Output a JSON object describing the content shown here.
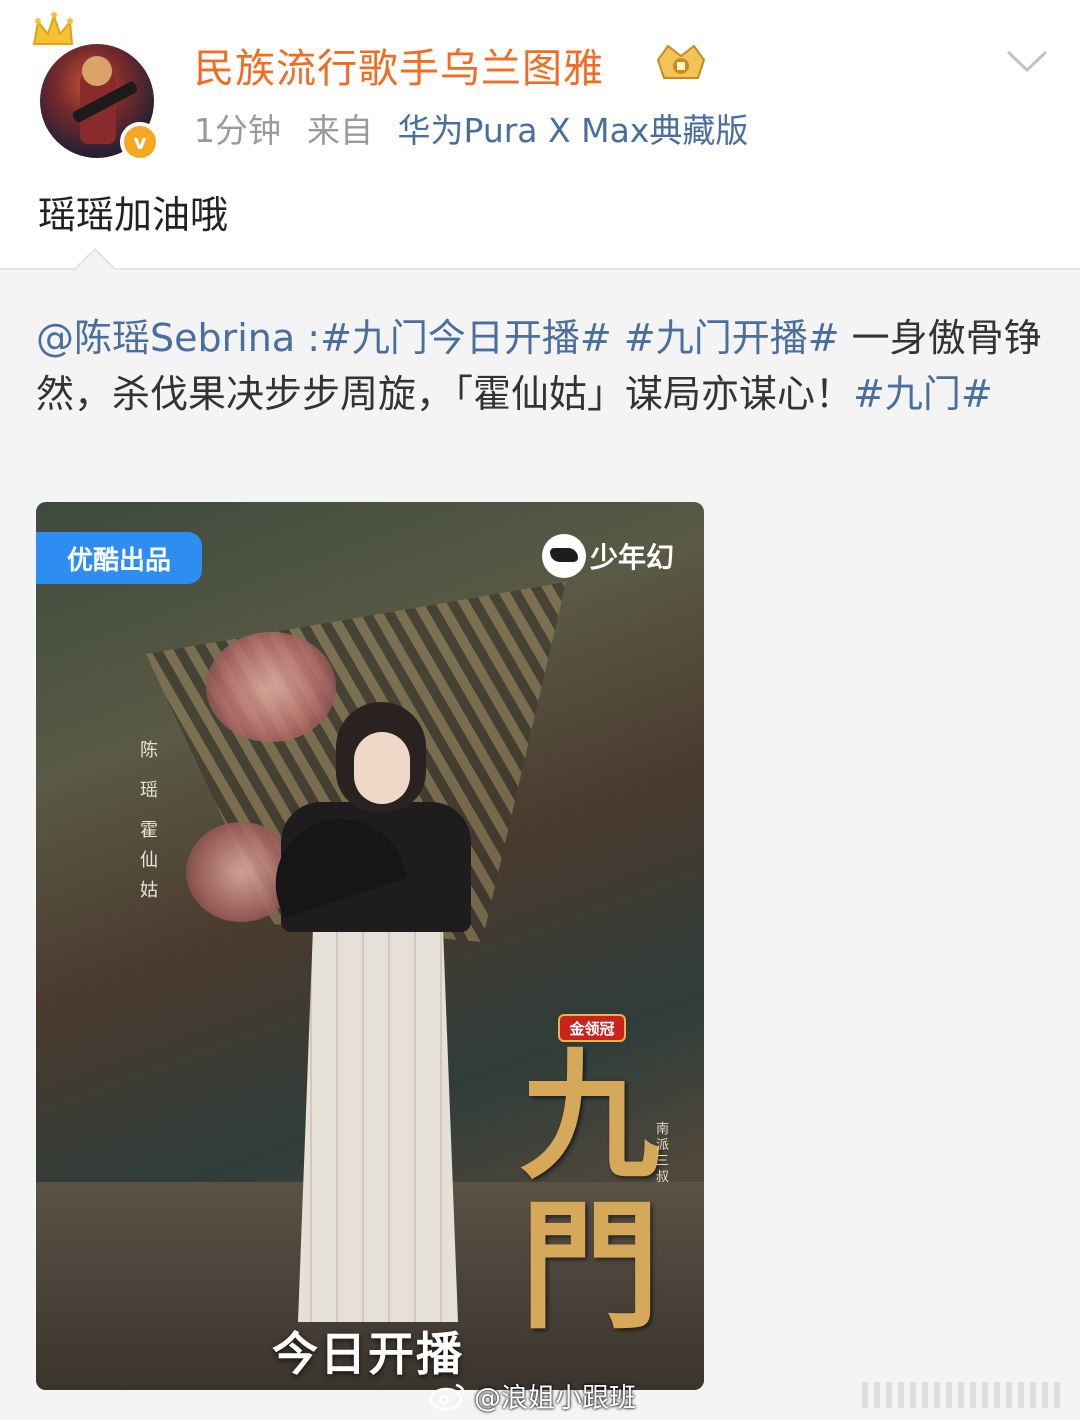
{
  "header": {
    "username": "民族流行歌手乌兰图雅",
    "time": "1分钟",
    "source_prefix": "来自",
    "device": "华为Pura X Max典藏版"
  },
  "post": {
    "text": "瑶瑶加油哦"
  },
  "repost": {
    "mention": "@陈瑶Sebrina",
    "sep": " :",
    "tag1": "#九门今日开播#",
    "tag2": "#九门开播#",
    "body": " 一身傲骨铮然，杀伐果决步步周旋，「霍仙姑」谋局亦谋心！",
    "tag3": "#九门#"
  },
  "poster": {
    "youku_tag": "优酷出品",
    "brand": "少年幻",
    "name_chars": [
      "陈",
      "瑶"
    ],
    "role_chars": [
      "霍",
      "仙",
      "姑"
    ],
    "sponsor": "金领冠",
    "title_line1": "九",
    "title_line2": "門",
    "author": "南派三叔",
    "air_text": "今日开播"
  },
  "watermark": {
    "text": "@浪姐小跟班"
  },
  "colors": {
    "username": "#f26c23",
    "link": "#4a6f9e",
    "meta": "#9a9a9a",
    "youku_blue": "#2d8df0",
    "title_gold": "#d6a85a"
  },
  "icons": [
    "crown-icon",
    "verified-badge-icon",
    "vip-crown-icon",
    "chevron-down-icon",
    "brand-mark-icon",
    "weibo-logo-icon"
  ]
}
